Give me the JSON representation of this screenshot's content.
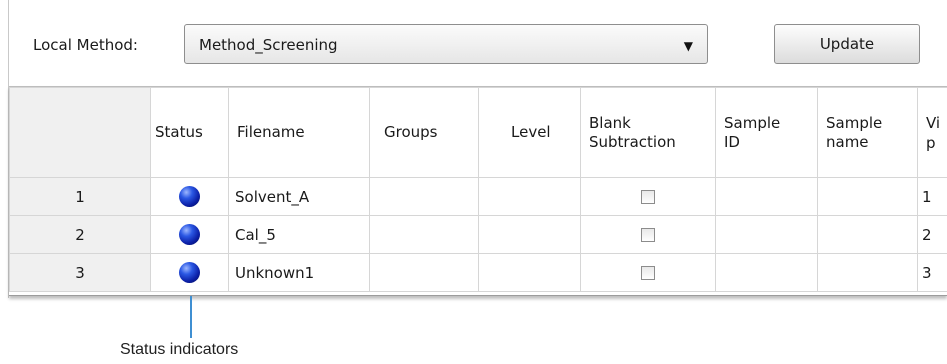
{
  "toolbar": {
    "method_label": "Local Method:",
    "method_value": "Method_Screening",
    "update_label": "Update"
  },
  "grid": {
    "columns": {
      "status": "Status",
      "filename": "Filename",
      "groups": "Groups",
      "level": "Level",
      "blank_subtraction": "Blank Subtraction",
      "sample_id": "Sample ID",
      "sample_name": "Sample name",
      "partial": "Vi\np"
    },
    "rows": [
      {
        "num": "1",
        "filename": "Solvent_A",
        "partial": "1"
      },
      {
        "num": "2",
        "filename": "Cal_5",
        "partial": "2"
      },
      {
        "num": "3",
        "filename": "Unknown1",
        "partial": "3"
      }
    ]
  },
  "annotation": {
    "label": "Status indicators"
  },
  "colors": {
    "status_indicator": "#1a3fd0",
    "callout_line": "#3f8fd2"
  }
}
